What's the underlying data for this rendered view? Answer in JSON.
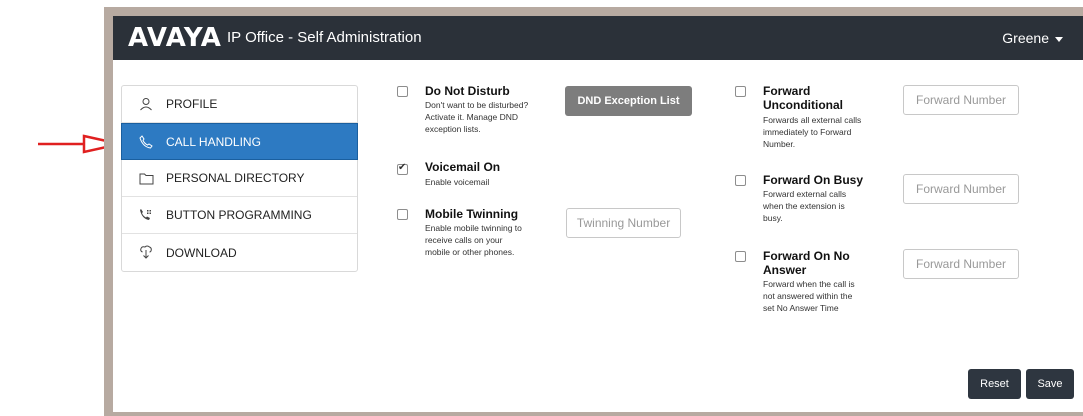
{
  "header": {
    "logo": "AVAYA",
    "title": "IP Office - Self Administration",
    "user": "Greene"
  },
  "nav": [
    {
      "label": "PROFILE",
      "icon": "person-icon"
    },
    {
      "label": "CALL HANDLING",
      "icon": "phone-icon",
      "active": true
    },
    {
      "label": "PERSONAL DIRECTORY",
      "icon": "folder-icon"
    },
    {
      "label": "BUTTON PROGRAMMING",
      "icon": "keypad-phone-icon"
    },
    {
      "label": "DOWNLOAD",
      "icon": "download-icon"
    }
  ],
  "options": {
    "dnd": {
      "title": "Do Not Disturb",
      "desc": [
        "Don't want to be disturbed?",
        "Activate it. Manage DND",
        "exception lists."
      ],
      "checked": false,
      "button": "DND Exception List"
    },
    "voicemail": {
      "title": "Voicemail On",
      "desc": [
        "Enable voicemail"
      ],
      "checked": true
    },
    "twinning": {
      "title": "Mobile Twinning",
      "desc": [
        "Enable mobile twinning to",
        "receive calls on your",
        "mobile or other phones."
      ],
      "checked": false,
      "placeholder": "Twinning Number"
    },
    "fwd_uncond": {
      "title": [
        "Forward",
        "Unconditional"
      ],
      "desc": [
        "Forwards all external calls",
        "immediately to Forward",
        "Number."
      ],
      "checked": false,
      "placeholder": "Forward Number"
    },
    "fwd_busy": {
      "title": [
        "Forward On Busy"
      ],
      "desc": [
        "Forward external calls",
        "when the extension is",
        "busy."
      ],
      "checked": false,
      "placeholder": "Forward Number"
    },
    "fwd_noans": {
      "title": [
        "Forward On No",
        "Answer"
      ],
      "desc": [
        "Forward when the call is",
        "not answered within the",
        "set No Answer Time"
      ],
      "checked": false,
      "placeholder": "Forward Number"
    }
  },
  "actions": {
    "reset": "Reset",
    "save": "Save"
  },
  "colors": {
    "topbar": "#2b3139",
    "active_nav": "#2d7ac2",
    "arrow": "#e02020"
  }
}
